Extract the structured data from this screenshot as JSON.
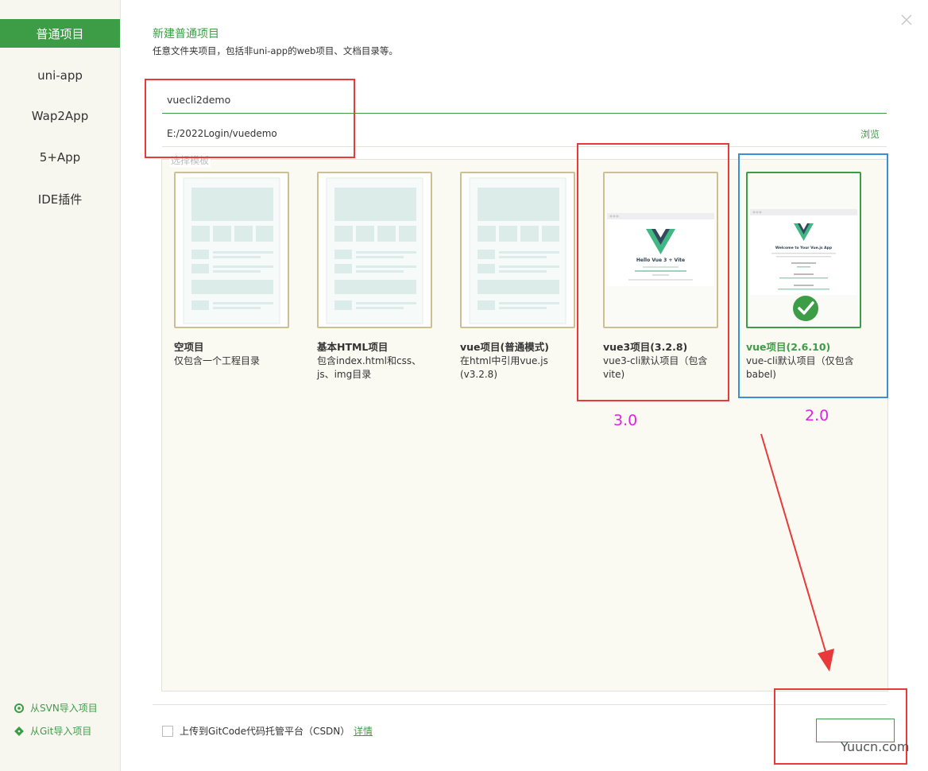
{
  "sidebar": {
    "items": [
      {
        "label": "普通项目",
        "active": true
      },
      {
        "label": "uni-app"
      },
      {
        "label": "Wap2App"
      },
      {
        "label": "5+App"
      },
      {
        "label": "IDE插件"
      }
    ],
    "import_svn": "从SVN导入项目",
    "import_git": "从Git导入项目"
  },
  "header": {
    "title": "新建普通项目",
    "subtitle": "任意文件夹项目，包括非uni-app的web项目、文档目录等。"
  },
  "form": {
    "project_name": "vuecli2demo",
    "project_path": "E:/2022Login/vuedemo",
    "browse_label": "浏览"
  },
  "templates": {
    "section_label": "选择模板",
    "items": [
      {
        "name": "空项目",
        "desc": "仅包含一个工程目录"
      },
      {
        "name": "基本HTML项目",
        "desc": "包含index.html和css、js、img目录"
      },
      {
        "name": "vue项目(普通模式)",
        "desc": "在html中引用vue.js (v3.2.8)"
      },
      {
        "name": "vue3项目(3.2.8)",
        "desc": "vue3-cli默认项目（包含vite)",
        "preview_heading": "Hello Vue 3 + Vite"
      },
      {
        "name": "vue项目(2.6.10)",
        "desc": "vue-cli默认项目（仅包含babel)",
        "selected": true,
        "preview_heading": "Welcome to Your Vue.js App"
      }
    ]
  },
  "footer": {
    "upload_label": "上传到GitCode代码托管平台（CSDN）",
    "details_label": "详情",
    "upload_checked": false
  },
  "annotations": {
    "label_vue3": "3.0",
    "label_vue2": "2.0",
    "watermark": "Yuucn.com"
  },
  "colors": {
    "accent": "#3d9d47",
    "annotation_red": "#e8393b",
    "annotation_blue": "#3a8fd9",
    "annotation_text": "#e021e8"
  }
}
